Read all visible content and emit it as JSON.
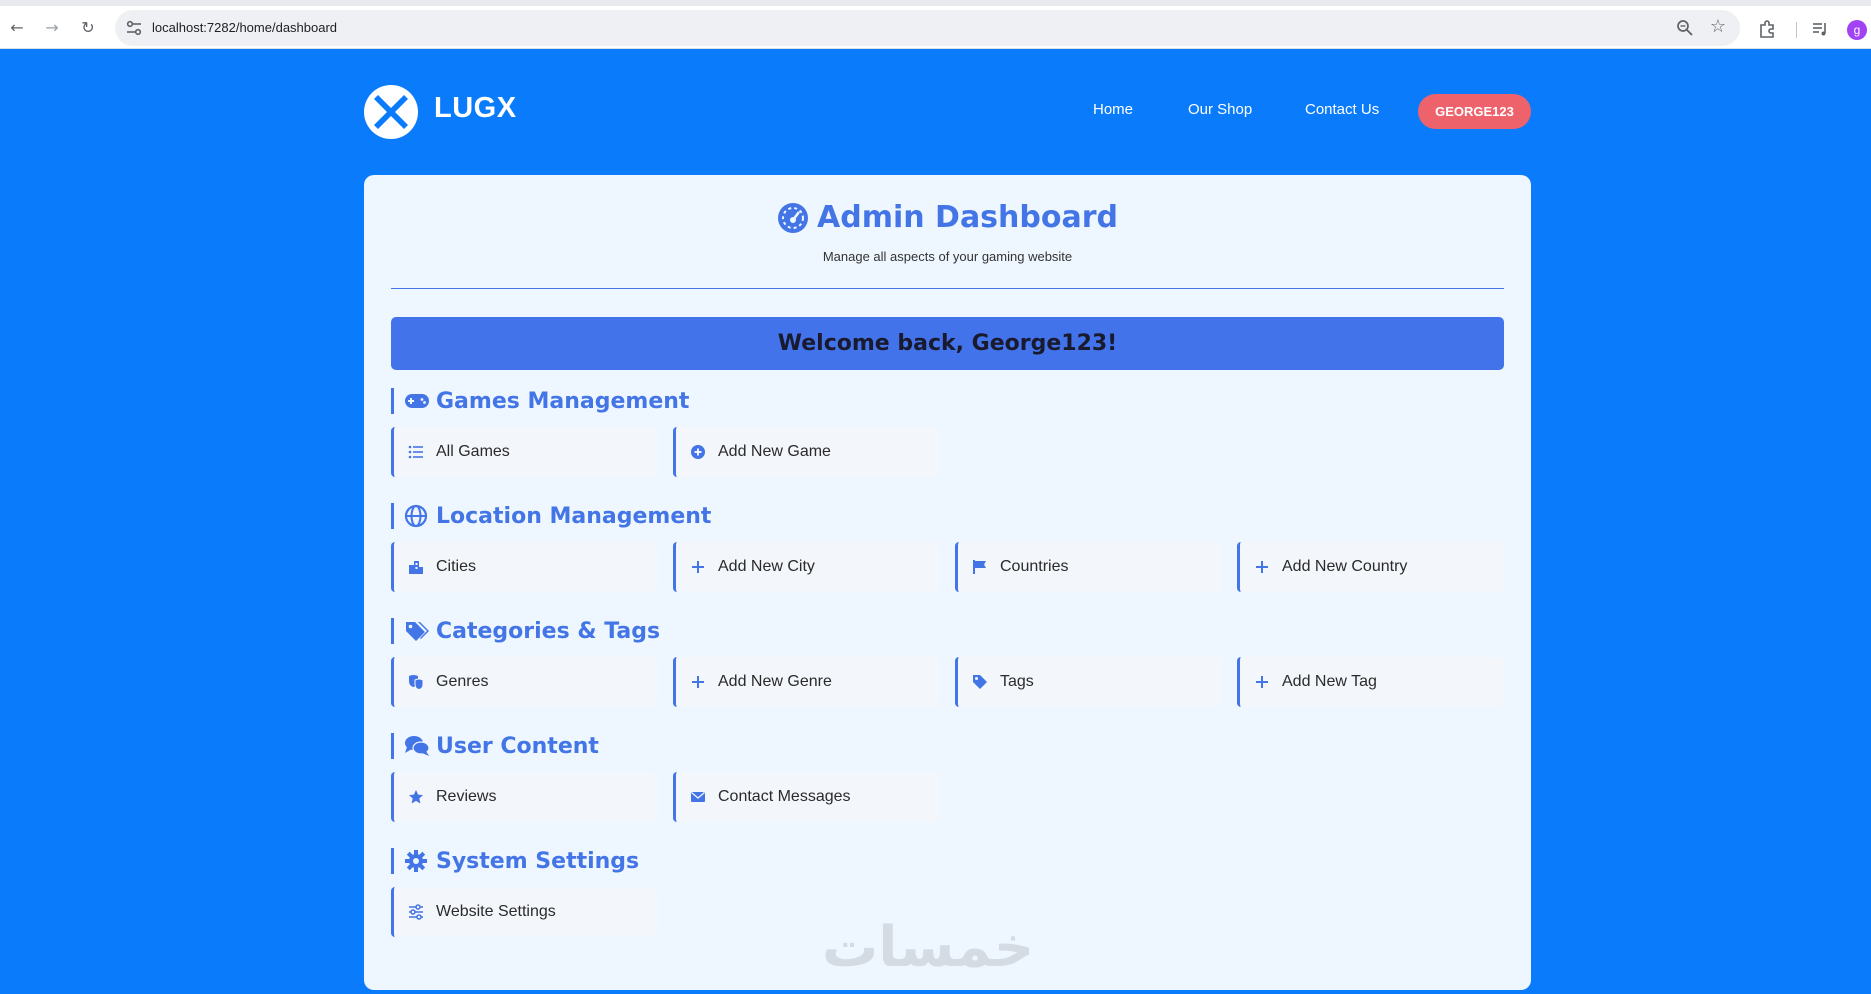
{
  "browser": {
    "url": "localhost:7282/home/dashboard",
    "profile_initial": "g"
  },
  "site": {
    "brand": "LUGX",
    "nav": [
      "Home",
      "Our Shop",
      "Contact Us"
    ],
    "user_button": "GEORGE123"
  },
  "dashboard": {
    "title": "Admin Dashboard",
    "subtitle": "Manage all aspects of your gaming website",
    "welcome": "Welcome back, George123!"
  },
  "sections": {
    "games": {
      "title": "Games Management",
      "icon": "gamepad-icon",
      "items": [
        {
          "label": "All Games",
          "icon": "list-icon"
        },
        {
          "label": "Add New Game",
          "icon": "plus-circle-icon"
        }
      ]
    },
    "location": {
      "title": "Location Management",
      "icon": "globe-icon",
      "items": [
        {
          "label": "Cities",
          "icon": "city-icon"
        },
        {
          "label": "Add New City",
          "icon": "plus-icon"
        },
        {
          "label": "Countries",
          "icon": "flag-icon"
        },
        {
          "label": "Add New Country",
          "icon": "plus-icon"
        }
      ]
    },
    "categories": {
      "title": "Categories & Tags",
      "icon": "tags-icon",
      "items": [
        {
          "label": "Genres",
          "icon": "masks-icon"
        },
        {
          "label": "Add New Genre",
          "icon": "plus-icon"
        },
        {
          "label": "Tags",
          "icon": "tag-icon"
        },
        {
          "label": "Add New Tag",
          "icon": "plus-icon"
        }
      ]
    },
    "user_content": {
      "title": "User Content",
      "icon": "comments-icon",
      "items": [
        {
          "label": "Reviews",
          "icon": "star-icon"
        },
        {
          "label": "Contact Messages",
          "icon": "envelope-icon"
        }
      ]
    },
    "system": {
      "title": "System Settings",
      "icon": "gear-icon",
      "items": [
        {
          "label": "Website Settings",
          "icon": "sliders-icon"
        }
      ]
    }
  },
  "watermark": "خمسات",
  "colors": {
    "page_bg": "#0a7cfb",
    "accent": "#4375e6",
    "card_bg": "#eef6ff",
    "user_button": "#ee626b"
  }
}
